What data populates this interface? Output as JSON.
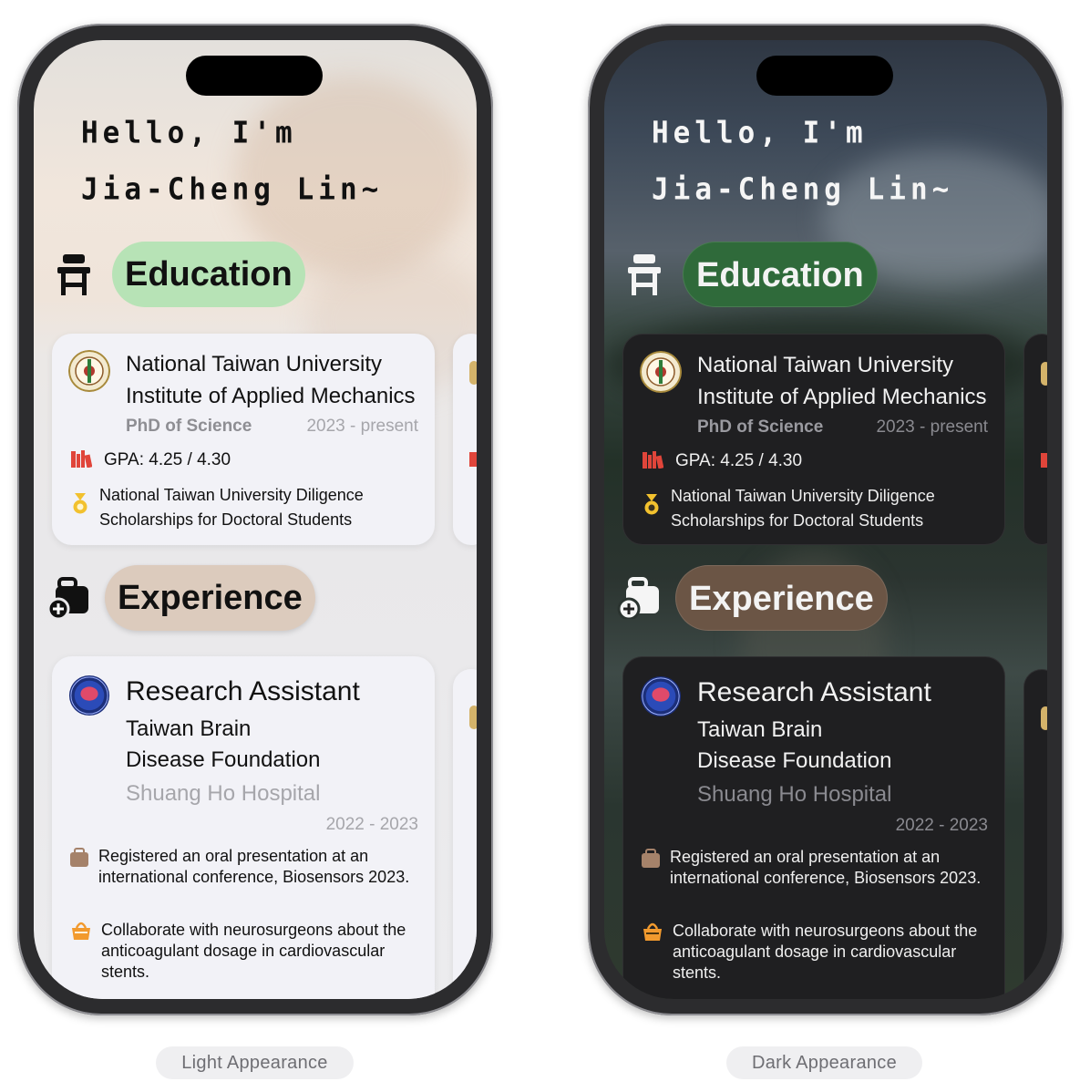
{
  "greeting": {
    "line1": "Hello, I'm",
    "line2": "Jia-Cheng Lin~"
  },
  "sections": {
    "education": "Education",
    "experience": "Experience"
  },
  "education": {
    "university": "National Taiwan University",
    "institute": "Institute of Applied Mechanics",
    "degree": "PhD of Science",
    "years": "2023 - present",
    "gpa": "GPA: 4.25 / 4.30",
    "award": "National Taiwan University Diligence Scholarships for Doctoral Students"
  },
  "experience": {
    "role": "Research Assistant",
    "org_line1": "Taiwan Brain",
    "org_line2": "Disease Foundation",
    "location": "Shuang Ho Hospital",
    "years": "2022 - 2023",
    "item1": "Registered an oral presentation at an international conference, Biosensors 2023.",
    "item2": "Collaborate with neurosurgeons about the anticoagulant dosage in cardiovascular stents."
  },
  "captions": {
    "light": "Light Appearance",
    "dark": "Dark Appearance"
  },
  "icons": {
    "education": "desk-chair-icon",
    "experience": "briefcase-plus-icon",
    "gpa": "books-icon",
    "award": "medal-icon",
    "item1": "briefcase-icon",
    "item2": "handbag-icon"
  },
  "colors": {
    "education_pill_light": "#b7e3b6",
    "education_pill_dark": "#2f6a3a",
    "experience_pill_light": "#dccbbd",
    "experience_pill_dark": "#6b5545",
    "gpa_icon": "#e0453a",
    "award_icon": "#f2c12e",
    "bag_icon": "#a5826a",
    "handbag_icon": "#f29a2e"
  }
}
